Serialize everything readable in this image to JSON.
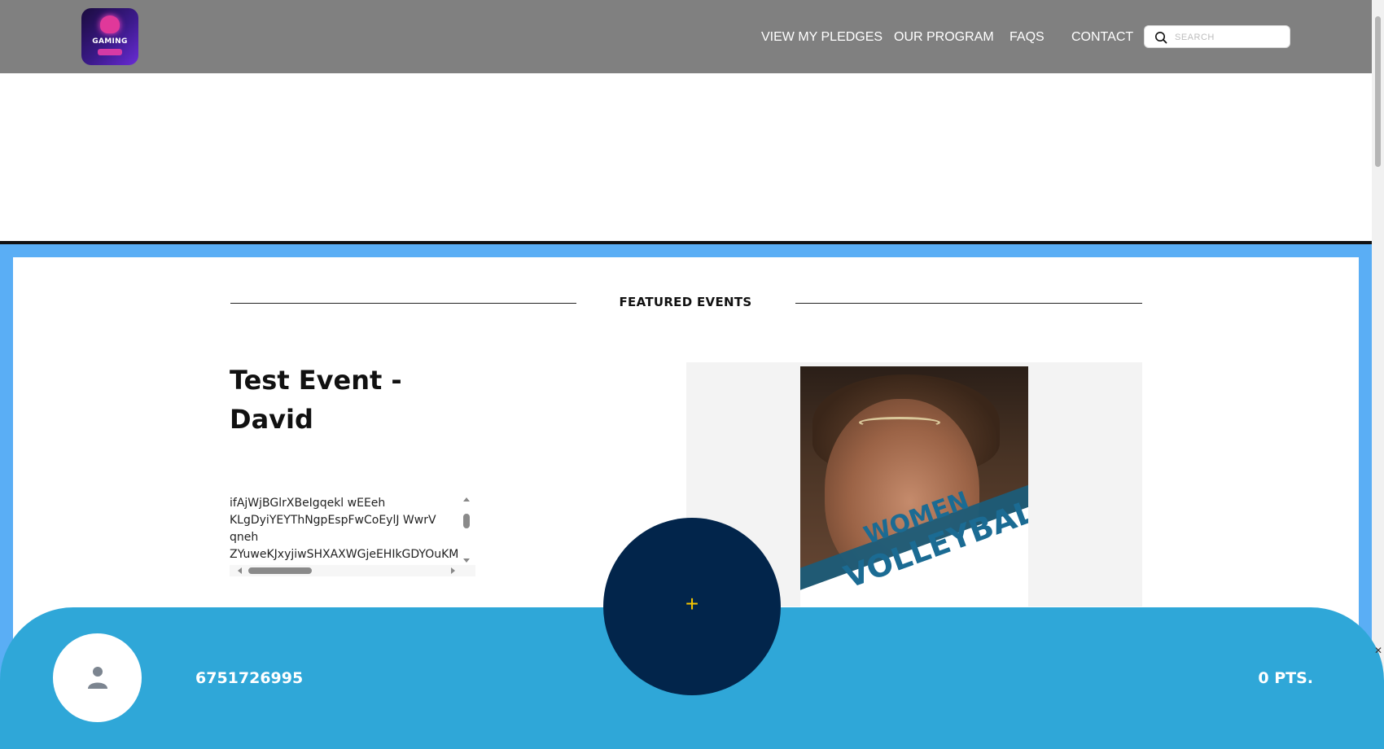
{
  "header": {
    "logo_text": "GAMING",
    "nav": [
      {
        "label": "VIEW MY PLEDGES"
      },
      {
        "label": "OUR PROGRAM"
      },
      {
        "label": "FAQS"
      },
      {
        "label": "CONTACT"
      }
    ],
    "search": {
      "placeholder": "SEARCH",
      "value": ""
    }
  },
  "featured": {
    "title": "FEATURED EVENTS"
  },
  "event": {
    "title": "Test Event - David",
    "description": "ifAjWjBGlrXBeIgqekl wEEeh\nKLgDyiYEYThNgpEspFwCoEylJ WwrV\nqneh\nZYuweKJxyjiwSHXAXWGjeEHIkGDYOuKM",
    "poster": {
      "line1": "WOMEN",
      "line2": "VOLLEYBALL"
    }
  },
  "bottom_bar": {
    "user_id": "6751726995",
    "points": "0 PTS.",
    "fab_symbol": "+"
  },
  "colors": {
    "header_bg": "#808080",
    "frame_blue": "#5aaef5",
    "bar_blue": "#2fa7d8",
    "fab_navy": "#02254b",
    "fab_plus": "#f5c400"
  }
}
